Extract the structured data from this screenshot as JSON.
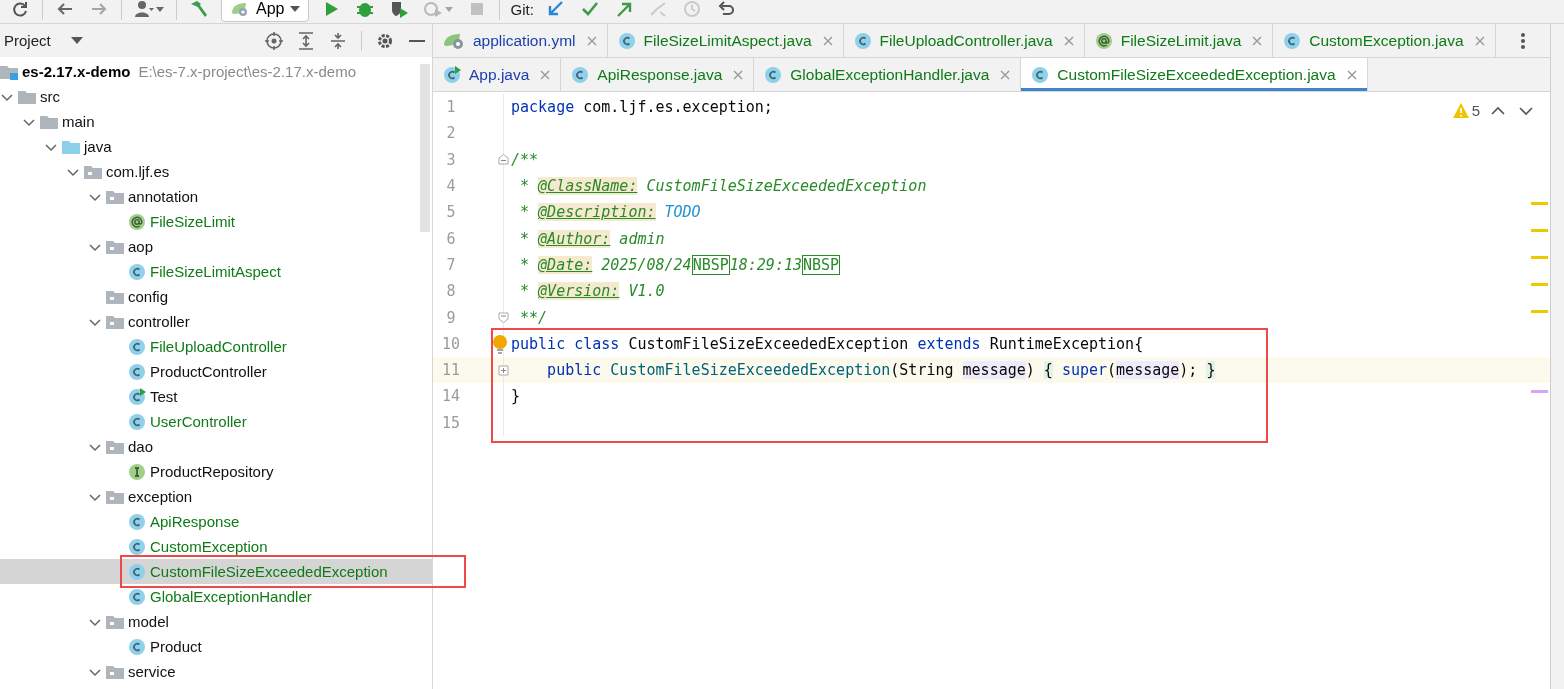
{
  "toolbar": {
    "groups": [
      [
        {
          "kind": "refresh",
          "disabled": false
        }
      ],
      [
        {
          "kind": "back",
          "disabled": false
        },
        {
          "kind": "forward",
          "disabled": true
        }
      ],
      [
        {
          "kind": "user",
          "disabled": false
        }
      ],
      [
        {
          "kind": "build",
          "disabled": false
        },
        {
          "kind": "run-config",
          "label": "App",
          "disabled": false
        },
        {
          "kind": "run",
          "disabled": false
        },
        {
          "kind": "debug",
          "disabled": false
        },
        {
          "kind": "coverage",
          "disabled": false
        },
        {
          "kind": "profile",
          "disabled": true
        },
        {
          "kind": "stop",
          "disabled": true
        }
      ],
      [
        {
          "kind": "label",
          "label": "Git:"
        },
        {
          "kind": "update",
          "disabled": false
        },
        {
          "kind": "commit",
          "disabled": false
        },
        {
          "kind": "push",
          "disabled": false
        },
        {
          "kind": "merge",
          "disabled": true
        },
        {
          "kind": "history",
          "disabled": true
        },
        {
          "kind": "rollback",
          "disabled": false
        }
      ]
    ]
  },
  "project": {
    "title": "Project",
    "tree": [
      {
        "kind": "module",
        "name": "es-2.17.x-demo",
        "path": "E:\\es-7.x-project\\es-2.17.x-demo",
        "selected": false,
        "children": [
          {
            "kind": "folder",
            "name": "src",
            "expanded": true,
            "selected": false,
            "children": [
              {
                "kind": "folder",
                "name": "main",
                "expanded": true,
                "selected": false,
                "children": [
                  {
                    "kind": "source-root",
                    "name": "java",
                    "expanded": true,
                    "selected": false,
                    "children": [
                      {
                        "kind": "package",
                        "name": "com.ljf.es",
                        "expanded": true,
                        "selected": false,
                        "children": [
                          {
                            "kind": "package",
                            "name": "annotation",
                            "expanded": true,
                            "selected": false,
                            "children": [
                              {
                                "kind": "annotation",
                                "name": "FileSizeLimit",
                                "color": "#0f7a17",
                                "selected": false
                              }
                            ]
                          },
                          {
                            "kind": "package",
                            "name": "aop",
                            "expanded": true,
                            "selected": false,
                            "children": [
                              {
                                "kind": "class",
                                "name": "FileSizeLimitAspect",
                                "color": "#0f7a17",
                                "selected": false
                              }
                            ]
                          },
                          {
                            "kind": "package",
                            "name": "config",
                            "selected": false
                          },
                          {
                            "kind": "package",
                            "name": "controller",
                            "expanded": true,
                            "selected": false,
                            "children": [
                              {
                                "kind": "class",
                                "name": "FileUploadController",
                                "color": "#0f7a17",
                                "selected": false
                              },
                              {
                                "kind": "class",
                                "name": "ProductController",
                                "color": "#111111",
                                "selected": false
                              },
                              {
                                "kind": "run-class",
                                "name": "Test",
                                "color": "#111111",
                                "selected": false
                              },
                              {
                                "kind": "class",
                                "name": "UserController",
                                "color": "#0f7a17",
                                "selected": false
                              }
                            ]
                          },
                          {
                            "kind": "package",
                            "name": "dao",
                            "expanded": true,
                            "selected": false,
                            "children": [
                              {
                                "kind": "interface",
                                "name": "ProductRepository",
                                "color": "#111111",
                                "selected": false
                              }
                            ]
                          },
                          {
                            "kind": "package",
                            "name": "exception",
                            "expanded": true,
                            "selected": false,
                            "children": [
                              {
                                "kind": "class",
                                "name": "ApiResponse",
                                "color": "#0f7a17",
                                "selected": false
                              },
                              {
                                "kind": "class",
                                "name": "CustomException",
                                "color": "#0f7a17",
                                "selected": false
                              },
                              {
                                "kind": "class",
                                "name": "CustomFileSizeExceededException",
                                "color": "#0f7a17",
                                "selected": true,
                                "outlined": true
                              },
                              {
                                "kind": "class",
                                "name": "GlobalExceptionHandler",
                                "color": "#0f7a17",
                                "selected": false
                              }
                            ]
                          },
                          {
                            "kind": "package",
                            "name": "model",
                            "expanded": true,
                            "selected": false,
                            "children": [
                              {
                                "kind": "class",
                                "name": "Product",
                                "color": "#111111",
                                "selected": false
                              }
                            ]
                          },
                          {
                            "kind": "package",
                            "name": "service",
                            "expanded": true,
                            "selected": false
                          }
                        ]
                      }
                    ]
                  }
                ]
              }
            ]
          }
        ]
      }
    ]
  },
  "editor": {
    "tab_rows": [
      [
        {
          "label": "application.yml",
          "kind": "spring-config",
          "color": "#1d3fae",
          "selected": false
        },
        {
          "label": "FileSizeLimitAspect.java",
          "kind": "class",
          "color": "#0f7a17",
          "selected": false
        },
        {
          "label": "FileUploadController.java",
          "kind": "class",
          "color": "#0f7a17",
          "selected": false
        },
        {
          "label": "FileSizeLimit.java",
          "kind": "annotation",
          "color": "#0f7a17",
          "selected": false
        },
        {
          "label": "CustomException.java",
          "kind": "class",
          "color": "#0f7a17",
          "selected": false
        }
      ],
      [
        {
          "label": "App.java",
          "kind": "run-class",
          "color": "#1d3fae",
          "selected": false
        },
        {
          "label": "ApiResponse.java",
          "kind": "class",
          "color": "#0f7a17",
          "selected": false
        },
        {
          "label": "GlobalExceptionHandler.java",
          "kind": "class",
          "color": "#0f7a17",
          "selected": false
        },
        {
          "label": "CustomFileSizeExceededException.java",
          "kind": "class",
          "color": "#0f7a17",
          "selected": true
        }
      ]
    ],
    "warnings": "5",
    "lines": [
      {
        "number": "1",
        "current": false,
        "tokens": [
          {
            "kind": "keyword",
            "text": "package"
          },
          {
            "kind": "plain",
            "text": " com.ljf.es.exception;"
          }
        ]
      },
      {
        "number": "2",
        "current": false
      },
      {
        "number": "3",
        "current": false,
        "fold": {
          "kind": "start"
        },
        "tokens": [
          {
            "kind": "comment",
            "text": "/**"
          }
        ]
      },
      {
        "number": "4",
        "current": false,
        "tokens": [
          {
            "kind": "comment",
            "text": " * "
          },
          {
            "kind": "doctag",
            "text": "@ClassName:"
          },
          {
            "kind": "comment",
            "text": " CustomFileSizeExceededException"
          }
        ]
      },
      {
        "number": "5",
        "current": false,
        "tokens": [
          {
            "kind": "comment",
            "text": " * "
          },
          {
            "kind": "doctag",
            "text": "@Description:"
          },
          {
            "kind": "todo",
            "text": " TODO"
          }
        ]
      },
      {
        "number": "6",
        "current": false,
        "tokens": [
          {
            "kind": "comment",
            "text": " * "
          },
          {
            "kind": "doctag",
            "text": "@Author:"
          },
          {
            "kind": "comment",
            "text": " admin"
          }
        ]
      },
      {
        "number": "7",
        "current": false,
        "tokens": [
          {
            "kind": "comment",
            "text": " * "
          },
          {
            "kind": "doctag",
            "text": "@Date:"
          },
          {
            "kind": "comment",
            "text": " 2025/08/24"
          },
          {
            "kind": "nbsp",
            "text": "NBSP"
          },
          {
            "kind": "comment",
            "text": "18:29:13"
          },
          {
            "kind": "nbsp",
            "text": "NBSP"
          }
        ]
      },
      {
        "number": "8",
        "current": false,
        "tokens": [
          {
            "kind": "comment",
            "text": " * "
          },
          {
            "kind": "doctag",
            "text": "@Version:"
          },
          {
            "kind": "comment",
            "text": " V1.0"
          }
        ]
      },
      {
        "number": "9",
        "current": false,
        "fold": {
          "kind": "end"
        },
        "tokens": [
          {
            "kind": "comment",
            "text": " **/"
          }
        ]
      },
      {
        "number": "10",
        "current": false,
        "outlined": true,
        "intention": true,
        "tokens": [
          {
            "kind": "keyword",
            "text": "public class"
          },
          {
            "kind": "plain",
            "text": " CustomFileSizeExceededException "
          },
          {
            "kind": "keyword",
            "text": "extends"
          },
          {
            "kind": "plain",
            "text": " RuntimeException{"
          }
        ]
      },
      {
        "number": "11",
        "current": true,
        "outlined": true,
        "fold": {
          "kind": "collapsed"
        },
        "tokens": [
          {
            "kind": "keyword",
            "text": "    public"
          },
          {
            "kind": "method",
            "text": " CustomFileSizeExceededException"
          },
          {
            "kind": "plain",
            "text": "(String "
          },
          {
            "kind": "param",
            "text": "message"
          },
          {
            "kind": "plain",
            "text": ") "
          },
          {
            "kind": "brace",
            "text": "{"
          },
          {
            "kind": "keyword",
            "text": " super"
          },
          {
            "kind": "plain",
            "text": "("
          },
          {
            "kind": "param",
            "text": "message"
          },
          {
            "kind": "plain",
            "text": "); "
          },
          {
            "kind": "brace",
            "text": "}"
          }
        ]
      },
      {
        "number": "14",
        "current": false,
        "outlined": true,
        "tokens": [
          {
            "kind": "plain",
            "text": "}"
          }
        ]
      },
      {
        "number": "15",
        "current": false,
        "outlined": true
      }
    ]
  }
}
